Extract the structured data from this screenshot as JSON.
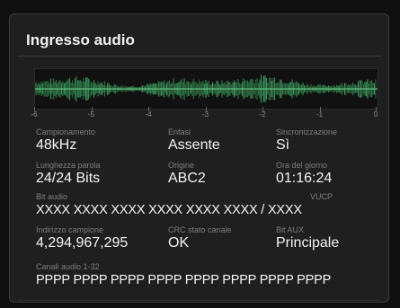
{
  "panel": {
    "title": "Ingresso audio"
  },
  "meter": {
    "scale": [
      "-6",
      "-5",
      "-4",
      "-3",
      "-2",
      "-1",
      "0"
    ],
    "accent": "#3b9a5a"
  },
  "fields": {
    "campionamento": {
      "label": "Campionamento",
      "value": "48kHz"
    },
    "enfasi": {
      "label": "Enfasi",
      "value": "Assente"
    },
    "sincronizzazione": {
      "label": "Sincronizzazione",
      "value": "Sì"
    },
    "lunghezza": {
      "label": "Lunghezza parola",
      "value": "24/24 Bits"
    },
    "origine": {
      "label": "Origine",
      "value": "ABC2"
    },
    "ora": {
      "label": "Ora del giorno",
      "value": "01:16:24"
    },
    "bit_audio": {
      "label": "Bit audio",
      "label2": "VUCP",
      "value": "XXXX XXXX XXXX XXXX XXXX XXXX / XXXX"
    },
    "indirizzo": {
      "label": "Indirizzo campione",
      "value": "4,294,967,295"
    },
    "crc": {
      "label": "CRC stato canale",
      "value": "OK"
    },
    "aux": {
      "label": "Bit AUX",
      "value": "Principale"
    },
    "canali": {
      "label": "Canali audio 1-32",
      "value": "PPPP PPPP PPPP PPPP PPPP PPPP PPPP PPPP"
    }
  }
}
